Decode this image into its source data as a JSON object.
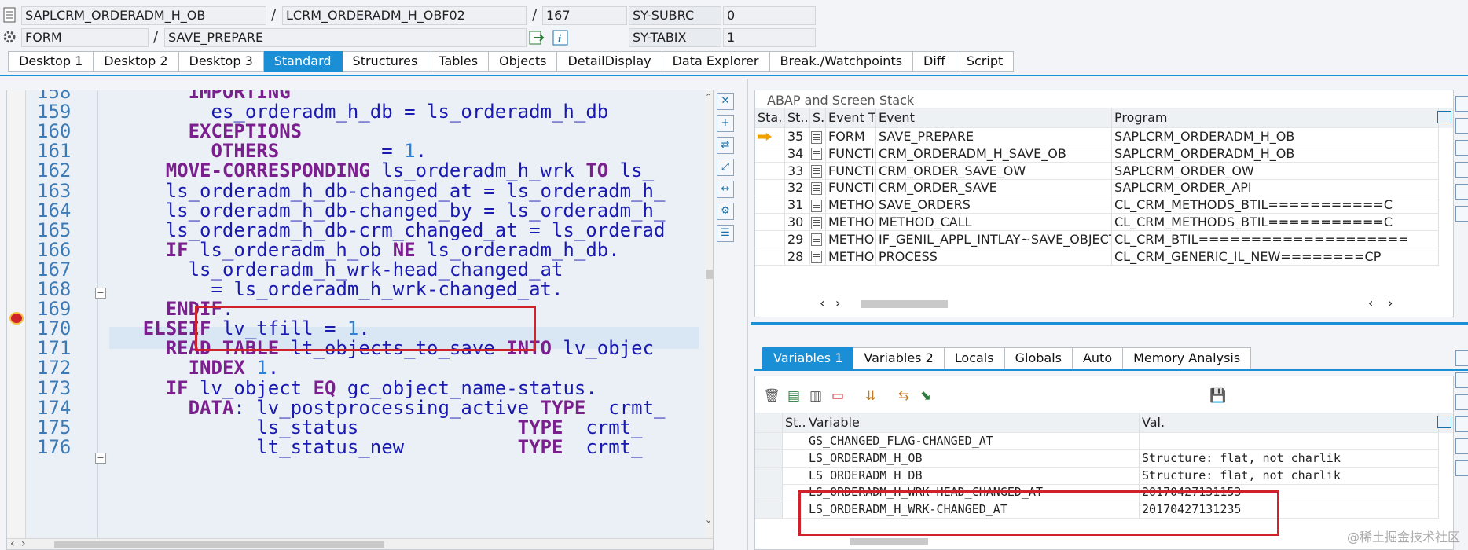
{
  "header": {
    "program": "SAPLCRM_ORDERADM_H_OB",
    "include": "LCRM_ORDERADM_H_OBF02",
    "line": "167",
    "subrc_label": "SY-SUBRC",
    "subrc_value": "0",
    "event_type": "FORM",
    "event_name": "SAVE_PREPARE",
    "tabix_label": "SY-TABIX",
    "tabix_value": "1",
    "sep": "/"
  },
  "tabs": [
    "Desktop 1",
    "Desktop 2",
    "Desktop 3",
    "Standard",
    "Structures",
    "Tables",
    "Objects",
    "DetailDisplay",
    "Data Explorer",
    "Break./Watchpoints",
    "Diff",
    "Script"
  ],
  "active_tab": "Standard",
  "code": {
    "lines": [
      {
        "n": "158",
        "ind": 8,
        "t": [
          [
            "kw",
            "IMPORTING"
          ]
        ]
      },
      {
        "n": "159",
        "ind": 10,
        "t": [
          [
            "id",
            "es_orderadm_h_db = ls_orderadm_h_db"
          ]
        ]
      },
      {
        "n": "160",
        "ind": 8,
        "t": [
          [
            "kw",
            "EXCEPTIONS"
          ]
        ]
      },
      {
        "n": "161",
        "ind": 10,
        "t": [
          [
            "kw",
            "OTHERS"
          ],
          [
            "id",
            "         = "
          ],
          [
            "num",
            "1"
          ],
          [
            "id",
            "."
          ]
        ]
      },
      {
        "n": "162",
        "ind": 6,
        "t": [
          [
            "kw",
            "MOVE-CORRESPONDING"
          ],
          [
            "id",
            " ls_orderadm_h_wrk "
          ],
          [
            "kw",
            "TO"
          ],
          [
            "id",
            " ls_"
          ]
        ]
      },
      {
        "n": "163",
        "ind": 6,
        "t": [
          [
            "id",
            "ls_orderadm_h_db-changed_at = ls_orderadm_h_"
          ]
        ]
      },
      {
        "n": "164",
        "ind": 6,
        "t": [
          [
            "id",
            "ls_orderadm_h_db-changed_by = ls_orderadm_h_"
          ]
        ]
      },
      {
        "n": "165",
        "ind": 6,
        "t": [
          [
            "id",
            "ls_orderadm_h_db-crm_changed_at = ls_orderad"
          ]
        ]
      },
      {
        "n": "166",
        "ind": 6,
        "t": [
          [
            "kw",
            "IF"
          ],
          [
            "id",
            " ls_orderadm_h_ob "
          ],
          [
            "kw",
            "NE"
          ],
          [
            "id",
            " ls_orderadm_h_db."
          ]
        ]
      },
      {
        "n": "167",
        "ind": 8,
        "t": [
          [
            "id",
            "ls_orderadm_h_wrk-head_changed_at"
          ]
        ]
      },
      {
        "n": "168",
        "ind": 10,
        "t": [
          [
            "id",
            "= ls_orderadm_h_wrk-changed_at."
          ]
        ]
      },
      {
        "n": "169",
        "ind": 6,
        "t": [
          [
            "kw",
            "ENDIF"
          ],
          [
            "id",
            "."
          ]
        ]
      },
      {
        "n": "170",
        "ind": 4,
        "t": [
          [
            "kw",
            "ELSEIF"
          ],
          [
            "id",
            " lv_tfill = "
          ],
          [
            "num",
            "1"
          ],
          [
            "id",
            "."
          ]
        ]
      },
      {
        "n": "171",
        "ind": 6,
        "t": [
          [
            "kw",
            "READ TABLE"
          ],
          [
            "id",
            " lt_objects_to_save "
          ],
          [
            "kw",
            "INTO"
          ],
          [
            "id",
            " lv_objec"
          ]
        ]
      },
      {
        "n": "172",
        "ind": 8,
        "t": [
          [
            "kw",
            "INDEX"
          ],
          [
            "id",
            " "
          ],
          [
            "num",
            "1"
          ],
          [
            "id",
            "."
          ]
        ]
      },
      {
        "n": "173",
        "ind": 6,
        "t": [
          [
            "kw",
            "IF"
          ],
          [
            "id",
            " lv_object "
          ],
          [
            "kw",
            "EQ"
          ],
          [
            "id",
            " gc_object_name-status."
          ]
        ]
      },
      {
        "n": "174",
        "ind": 8,
        "t": [
          [
            "kw",
            "DATA"
          ],
          [
            "id",
            ": lv_postprocessing_active "
          ],
          [
            "kw",
            "TYPE"
          ],
          [
            "id",
            "  crmt_"
          ]
        ]
      },
      {
        "n": "175",
        "ind": 8,
        "t": [
          [
            "id",
            "      ls_status              "
          ],
          [
            "kw",
            "TYPE"
          ],
          [
            "id",
            "  crmt_"
          ]
        ]
      },
      {
        "n": "176",
        "ind": 8,
        "t": [
          [
            "id",
            "      lt_status_new          "
          ],
          [
            "kw",
            "TYPE"
          ],
          [
            "id",
            "  crmt_"
          ]
        ]
      }
    ]
  },
  "stack": {
    "title": "ABAP and Screen Stack",
    "headers": [
      "Sta...",
      "St...",
      "S...",
      "Event T...",
      "Event",
      "Program"
    ],
    "rows": [
      {
        "level": "35",
        "type": "FORM",
        "event": "SAVE_PREPARE",
        "program": "SAPLCRM_ORDERADM_H_OB"
      },
      {
        "level": "34",
        "type": "FUNCTIO...",
        "event": "CRM_ORDERADM_H_SAVE_OB",
        "program": "SAPLCRM_ORDERADM_H_OB"
      },
      {
        "level": "33",
        "type": "FUNCTIO...",
        "event": "CRM_ORDER_SAVE_OW",
        "program": "SAPLCRM_ORDER_OW"
      },
      {
        "level": "32",
        "type": "FUNCTIO...",
        "event": "CRM_ORDER_SAVE",
        "program": "SAPLCRM_ORDER_API"
      },
      {
        "level": "31",
        "type": "METHOD",
        "event": "SAVE_ORDERS",
        "program": "CL_CRM_METHODS_BTIL===========C"
      },
      {
        "level": "30",
        "type": "METHOD",
        "event": "METHOD_CALL",
        "program": "CL_CRM_METHODS_BTIL===========C"
      },
      {
        "level": "29",
        "type": "METHOD",
        "event": "IF_GENIL_APPL_INTLAY~SAVE_OBJECTS",
        "program": "CL_CRM_BTIL===================="
      },
      {
        "level": "28",
        "type": "METHOD",
        "event": "PROCESS",
        "program": "CL_CRM_GENERIC_IL_NEW========CP"
      }
    ]
  },
  "var_tabs": [
    "Variables 1",
    "Variables 2",
    "Locals",
    "Globals",
    "Auto",
    "Memory Analysis"
  ],
  "active_var_tab": "Variables 1",
  "vars": {
    "headers": [
      "St...",
      "Variable",
      "Val."
    ],
    "rows": [
      {
        "name": "GS_CHANGED_FLAG-CHANGED_AT",
        "value": ""
      },
      {
        "name": "LS_ORDERADM_H_OB",
        "value": "Structure: flat, not charlik"
      },
      {
        "name": "LS_ORDERADM_H_DB",
        "value": "Structure: flat, not charlik"
      },
      {
        "name": "LS_ORDERADM_H_WRK-HEAD_CHANGED_AT",
        "value": "20170427131153"
      },
      {
        "name": "LS_ORDERADM_H_WRK-CHANGED_AT",
        "value": "20170427131235"
      }
    ]
  },
  "watermark": "@稀土掘金技术社区",
  "colors": {
    "accent": "#1b8fd6",
    "keyword": "#7b1f8f",
    "identifier": "#1a1ab0",
    "number": "#2f7fd4",
    "highlight_box": "#d0222a"
  }
}
